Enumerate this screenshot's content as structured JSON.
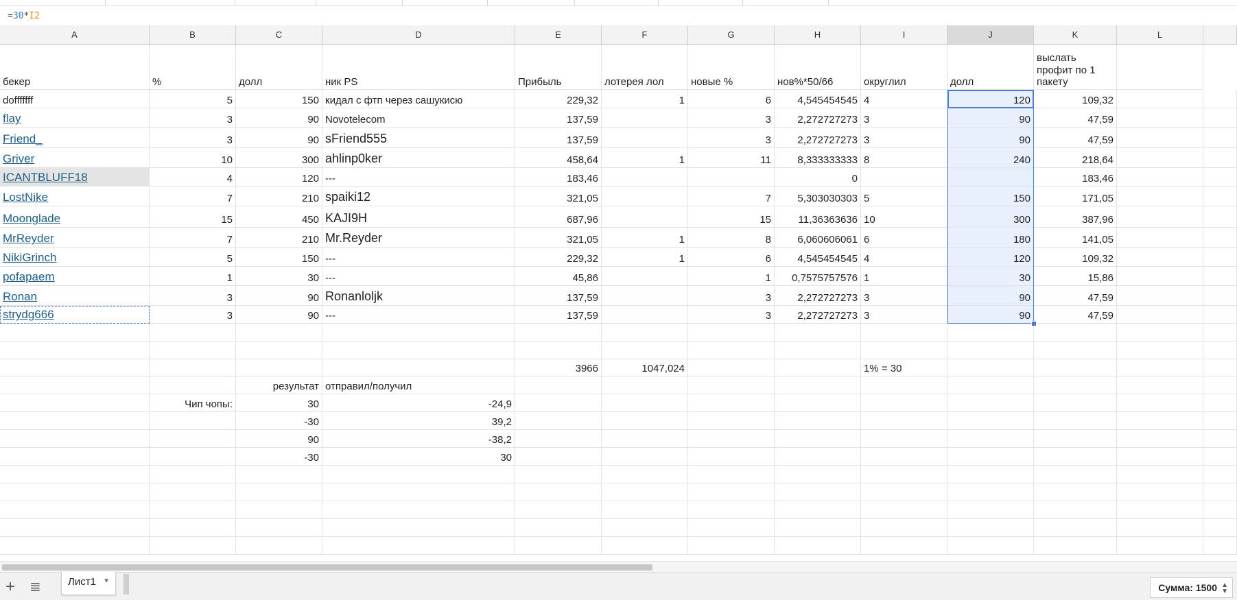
{
  "formula_bar": {
    "eq": "=",
    "num": "30",
    "op": "*",
    "ref": "I2"
  },
  "columns": [
    "A",
    "B",
    "C",
    "D",
    "E",
    "F",
    "G",
    "H",
    "I",
    "J",
    "K",
    "L"
  ],
  "selected_column": "J",
  "header_row": [
    "бекер",
    "%",
    "долл",
    "ник PS",
    "Прибыль",
    "лотерея лол",
    "новые %",
    "нов%*50/66",
    "округлил",
    "долл",
    "выслать профит по 1 пакету",
    ""
  ],
  "rows": [
    [
      "dofffffff",
      "5",
      "150",
      "кидал с фтп через сашукисю",
      "229,32",
      "1",
      "6",
      "4,545454545",
      "4",
      "120",
      "109,32",
      ""
    ],
    [
      "flay",
      "3",
      "90",
      "Novotelecom",
      "137,59",
      "",
      "3",
      "2,272727273",
      "3",
      "90",
      "47,59",
      ""
    ],
    [
      "Friend_",
      "3",
      "90",
      "sFriend555",
      "137,59",
      "",
      "3",
      "2,272727273",
      "3",
      "90",
      "47,59",
      ""
    ],
    [
      "Griver",
      "10",
      "300",
      "ahlinp0ker",
      "458,64",
      "1",
      "11",
      "8,333333333",
      "8",
      "240",
      "218,64",
      ""
    ],
    [
      "ICANTBLUFF18",
      "4",
      "120",
      "---",
      "183,46",
      "",
      "",
      "0",
      "",
      "",
      "183,46",
      ""
    ],
    [
      "LostNike",
      "7",
      "210",
      "spaiki12",
      "321,05",
      "",
      "7",
      "5,303030303",
      "5",
      "150",
      "171,05",
      ""
    ],
    [
      "Moonglade",
      "15",
      "450",
      "KAJI9H",
      "687,96",
      "",
      "15",
      "11,36363636",
      "10",
      "300",
      "387,96",
      ""
    ],
    [
      "MrReyder",
      "7",
      "210",
      "Mr.Reyder",
      "321,05",
      "1",
      "8",
      "6,060606061",
      "6",
      "180",
      "141,05",
      ""
    ],
    [
      "NikiGrinch",
      "5",
      "150",
      "---",
      "229,32",
      "1",
      "6",
      "4,545454545",
      "4",
      "120",
      "109,32",
      ""
    ],
    [
      "pofapaem",
      "1",
      "30",
      "---",
      "45,86",
      "",
      "1",
      "0,7575757576",
      "1",
      "30",
      "15,86",
      ""
    ],
    [
      "Ronan",
      "3",
      "90",
      "Ronanloljk",
      "137,59",
      "",
      "3",
      "2,272727273",
      "3",
      "90",
      "47,59",
      ""
    ],
    [
      "strydg666",
      "3",
      "90",
      "---",
      "137,59",
      "",
      "3",
      "2,272727273",
      "3",
      "90",
      "47,59",
      ""
    ],
    [
      "",
      "",
      "",
      "",
      "",
      "",
      "",
      "",
      "",
      "",
      "",
      ""
    ],
    [
      "",
      "",
      "",
      "",
      "",
      "",
      "",
      "",
      "",
      "",
      "",
      ""
    ],
    [
      "",
      "",
      "",
      "",
      "3966",
      "1047,024",
      "",
      "",
      "1% = 30",
      "",
      "",
      ""
    ],
    [
      "",
      "",
      "результат",
      "отправил/получил",
      "",
      "",
      "",
      "",
      "",
      "",
      "",
      ""
    ],
    [
      "",
      "Чип чопы:",
      "30",
      "-24,9",
      "",
      "",
      "",
      "",
      "",
      "",
      "",
      ""
    ],
    [
      "",
      "",
      "-30",
      "39,2",
      "",
      "",
      "",
      "",
      "",
      "",
      "",
      ""
    ],
    [
      "",
      "",
      "90",
      "-38,2",
      "",
      "",
      "",
      "",
      "",
      "",
      "",
      ""
    ],
    [
      "",
      "",
      "-30",
      "30",
      "",
      "",
      "",
      "",
      "",
      "",
      "",
      ""
    ],
    [
      "",
      "",
      "",
      "",
      "",
      "",
      "",
      "",
      "",
      "",
      "",
      ""
    ],
    [
      "",
      "",
      "",
      "",
      "",
      "",
      "",
      "",
      "",
      "",
      "",
      ""
    ],
    [
      "",
      "",
      "",
      "",
      "",
      "",
      "",
      "",
      "",
      "",
      "",
      ""
    ],
    [
      "",
      "",
      "",
      "",
      "",
      "",
      "",
      "",
      "",
      "",
      "",
      ""
    ],
    [
      "",
      "",
      "",
      "",
      "",
      "",
      "",
      "",
      "",
      "",
      "",
      ""
    ]
  ],
  "sheet_tab": "Лист1",
  "sum_label": "Сумма: 1500"
}
